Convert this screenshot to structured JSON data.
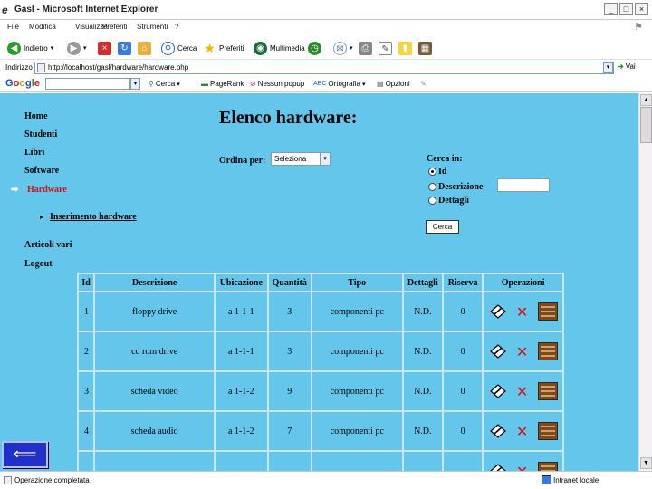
{
  "window": {
    "title": "Gasl - Microsoft Internet Explorer"
  },
  "menu": [
    "File",
    "Modifica",
    "Visualizza",
    "Preferiti",
    "Strumenti",
    "?"
  ],
  "toolbar": {
    "back_label": "Indietro",
    "search_label": "Cerca",
    "favorites_label": "Preferiti",
    "multimedia_label": "Multimedia"
  },
  "address": {
    "label": "Indirizzo",
    "url": "http://localhost/gasl/hardware/hardware.php",
    "go_label": "Vai"
  },
  "googlebar": {
    "logo": [
      "G",
      "o",
      "o",
      "g",
      "l",
      "e"
    ],
    "search_label": "Cerca",
    "pagerank_label": "PageRank",
    "popup_label": "Nessun popup",
    "spell_label": "Ortografia",
    "options_label": "Opzioni"
  },
  "sidebar": {
    "items": [
      {
        "label": "Home",
        "active": false
      },
      {
        "label": "Studenti",
        "active": false
      },
      {
        "label": "Libri",
        "active": false
      },
      {
        "label": "Software",
        "active": false
      },
      {
        "label": "Hardware",
        "active": true
      },
      {
        "label": "Articoli vari",
        "active": false
      },
      {
        "label": "Logout",
        "active": false
      }
    ],
    "sub_item": "Inserimento hardware"
  },
  "main": {
    "title": "Elenco hardware:",
    "order_label": "Ordina per:",
    "order_value": "Seleziona",
    "search_label": "Cerca in:",
    "search_options": [
      "Id",
      "Descrizione",
      "Dettagli"
    ],
    "search_selected": "Id",
    "search_button": "Cerca"
  },
  "table": {
    "headers": [
      "Id",
      "Descrizione",
      "Ubicazione",
      "Quantità",
      "Tipo",
      "Dettagli",
      "Riserva",
      "Operazioni"
    ],
    "rows": [
      [
        "1",
        "floppy drive",
        "a 1-1-1",
        "3",
        "componenti pc",
        "N.D.",
        "0"
      ],
      [
        "2",
        "cd rom drive",
        "a 1-1-1",
        "3",
        "componenti pc",
        "N.D.",
        "0"
      ],
      [
        "3",
        "scheda video",
        "a 1-1-2",
        "9",
        "componenti pc",
        "N.D.",
        "0"
      ],
      [
        "4",
        "scheda audio",
        "a 1-1-2",
        "7",
        "componenti pc",
        "N.D.",
        "0"
      ],
      [
        "",
        "",
        "",
        "",
        "",
        "",
        ""
      ]
    ]
  },
  "status": {
    "text": "Operazione completata",
    "zone": "Intranet locale"
  }
}
